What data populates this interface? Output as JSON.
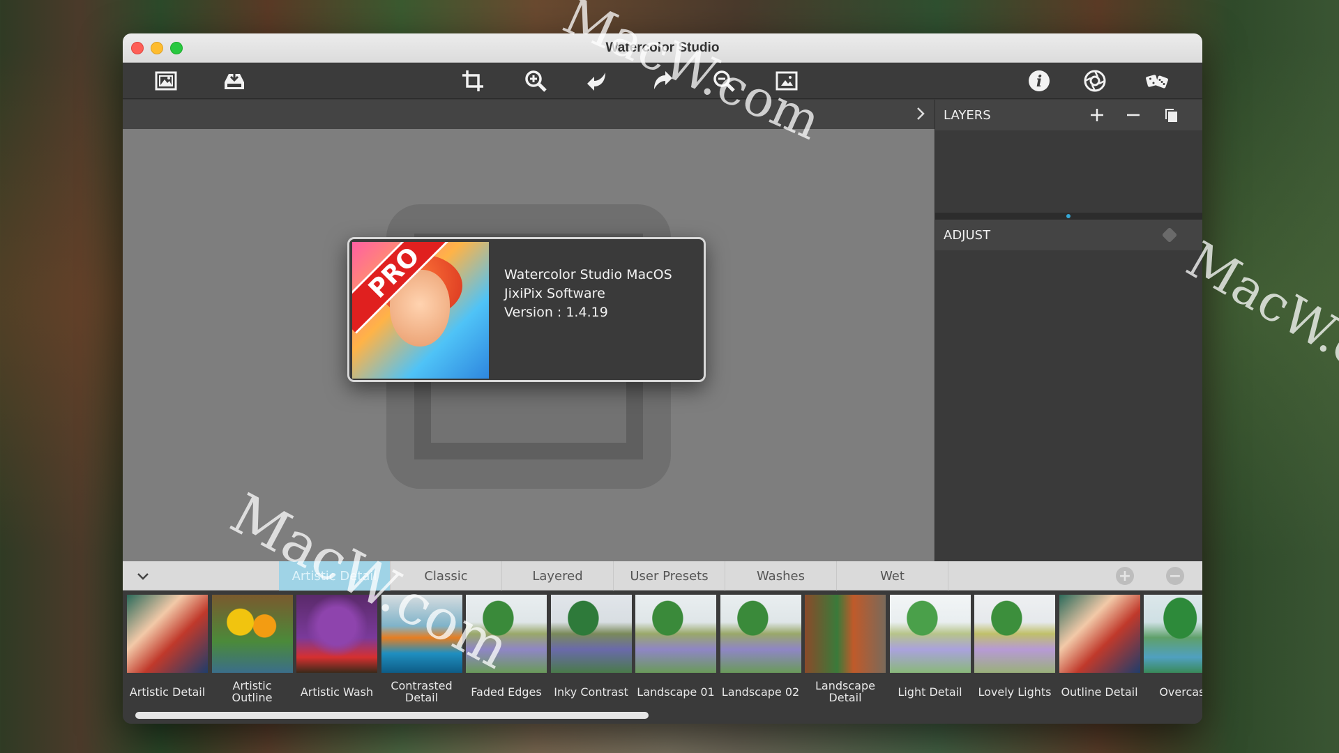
{
  "window": {
    "title": "Watercolor Studio"
  },
  "toolbar": {
    "buttons": [
      {
        "name": "open-image",
        "icon": "image-frame-icon"
      },
      {
        "name": "save-image",
        "icon": "tray-download-icon"
      },
      {
        "name": "crop",
        "icon": "crop-icon"
      },
      {
        "name": "zoom-in",
        "icon": "zoom-in-icon"
      },
      {
        "name": "undo",
        "icon": "undo-arrow-icon"
      },
      {
        "name": "redo",
        "icon": "redo-arrow-icon"
      },
      {
        "name": "zoom-out",
        "icon": "zoom-out-icon"
      },
      {
        "name": "fit-image",
        "icon": "image-frame-icon"
      },
      {
        "name": "info",
        "icon": "info-icon"
      },
      {
        "name": "settings",
        "icon": "aperture-icon"
      },
      {
        "name": "random",
        "icon": "dice-icon"
      }
    ]
  },
  "about": {
    "badge": "PRO",
    "line1": "Watercolor Studio MacOS",
    "line2": "JixiPix Software",
    "line3": "Version : 1.4.19"
  },
  "panels": {
    "layers_title": "LAYERS",
    "adjust_title": "ADJUST"
  },
  "preset_tabs": [
    {
      "label": "Artistic Detail",
      "active": true
    },
    {
      "label": "Classic",
      "active": false
    },
    {
      "label": "Layered",
      "active": false
    },
    {
      "label": "User Presets",
      "active": false
    },
    {
      "label": "Washes",
      "active": false
    },
    {
      "label": "Wet",
      "active": false
    }
  ],
  "presets": [
    {
      "label": "Artistic Detail",
      "thumb": "portrait"
    },
    {
      "label": "Artistic\nOutline",
      "thumb": "sunflower"
    },
    {
      "label": "Artistic Wash",
      "thumb": "lilac"
    },
    {
      "label": "Contrasted\nDetail",
      "thumb": "boat"
    },
    {
      "label": "Faded Edges",
      "thumb": "landscape"
    },
    {
      "label": "Inky Contrast",
      "thumb": "landscape-inky"
    },
    {
      "label": "Landscape 01",
      "thumb": "landscape"
    },
    {
      "label": "Landscape 02",
      "thumb": "landscape"
    },
    {
      "label": "Landscape\nDetail",
      "thumb": "garden"
    },
    {
      "label": "Light Detail",
      "thumb": "light"
    },
    {
      "label": "Lovely Lights",
      "thumb": "lovely"
    },
    {
      "label": "Outline Detail",
      "thumb": "portrait"
    },
    {
      "label": "Overcast",
      "thumb": "overcast"
    }
  ],
  "watermark": "MacW.com",
  "colors": {
    "active_tab": "#9fd3e6",
    "accent_dot": "#35a8d6",
    "pro_band": "#e0201f"
  }
}
